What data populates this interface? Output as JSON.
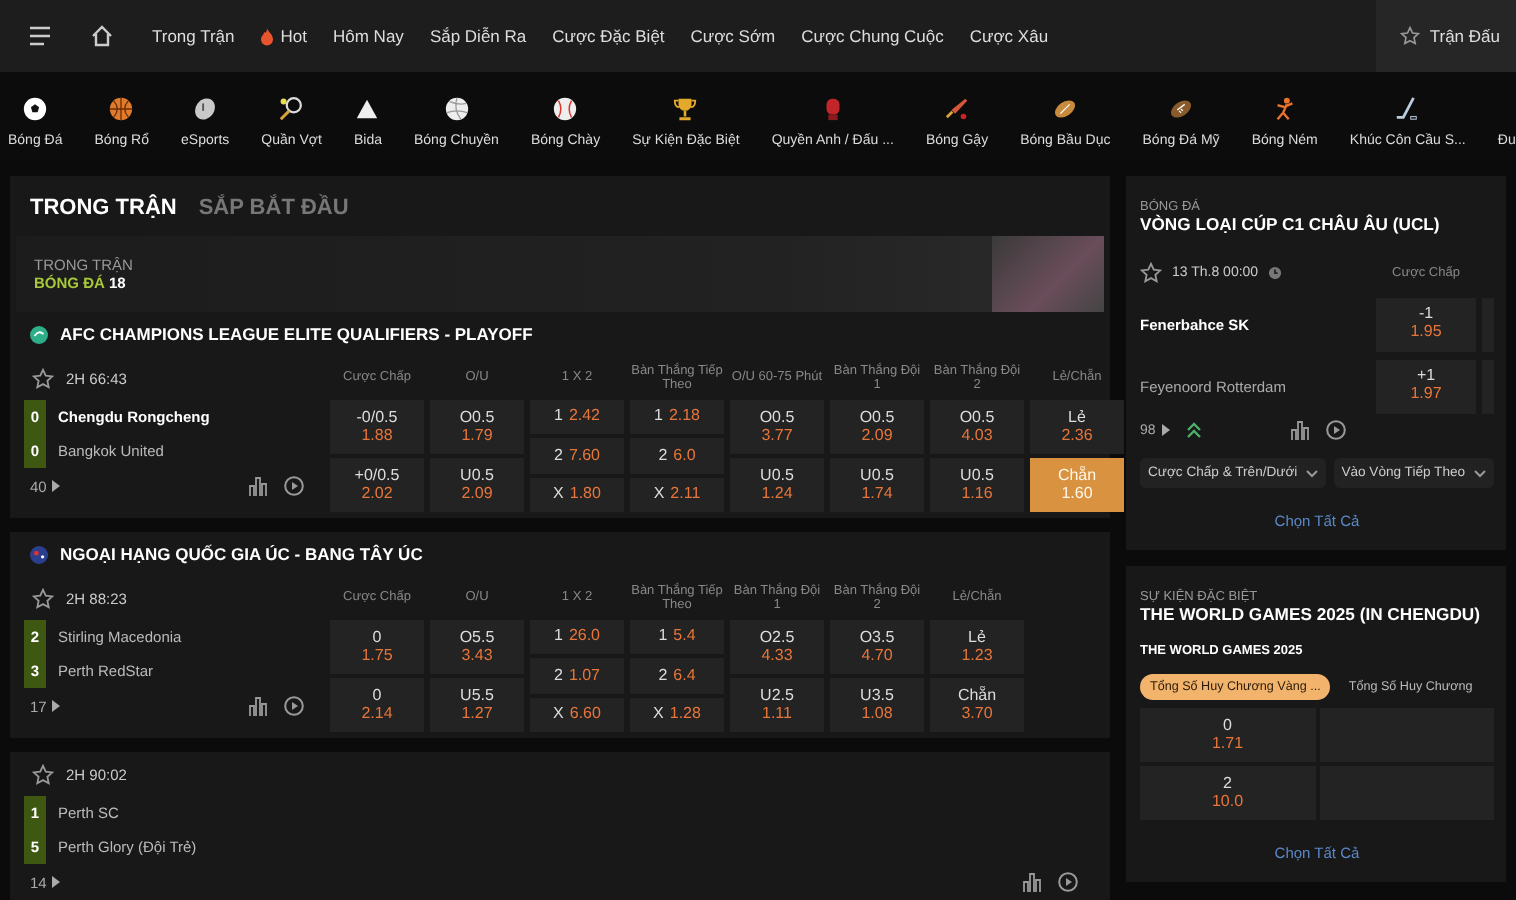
{
  "top_nav": {
    "items": [
      {
        "label": "Trong Trận"
      },
      {
        "label": "Hot"
      },
      {
        "label": "Hôm Nay"
      },
      {
        "label": "Sắp Diễn Ra"
      },
      {
        "label": "Cược Đặc Biệt"
      },
      {
        "label": "Cược Sớm"
      },
      {
        "label": "Cược Chung Cuộc"
      },
      {
        "label": "Cược Xâu"
      }
    ],
    "right_link": "Trận Đấu"
  },
  "sports": [
    {
      "label": "Bóng Đá"
    },
    {
      "label": "Bóng Rổ"
    },
    {
      "label": "eSports"
    },
    {
      "label": "Quần Vợt"
    },
    {
      "label": "Bida"
    },
    {
      "label": "Bóng Chuyền"
    },
    {
      "label": "Bóng Chày"
    },
    {
      "label": "Sự Kiện Đặc Biệt"
    },
    {
      "label": "Quyền Anh / Đấu ..."
    },
    {
      "label": "Bóng Gậy"
    },
    {
      "label": "Bóng Bầu Dục"
    },
    {
      "label": "Bóng Đá Mỹ"
    },
    {
      "label": "Bóng Ném"
    },
    {
      "label": "Khúc Côn Cầu S..."
    },
    {
      "label": "Đu"
    }
  ],
  "main": {
    "tabs": [
      {
        "label": "TRONG TRẬN",
        "selected": true
      },
      {
        "label": "SẮP BẮT ĐẦU",
        "selected": false
      }
    ],
    "banner": {
      "caption": "TRONG TRẬN",
      "sport": "BÓNG ĐÁ",
      "count": "18"
    },
    "leagues": [
      {
        "name": "AFC CHAMPIONS LEAGUE ELITE QUALIFIERS - PLAYOFF",
        "matches": [
          {
            "time": "2H 66:43",
            "more": "40",
            "teams": [
              {
                "score": "0",
                "name": "Chengdu Rongcheng",
                "bold": true
              },
              {
                "score": "0",
                "name": "Bangkok United",
                "bold": false
              }
            ],
            "columns": [
              {
                "header": "Cược Chấp",
                "kind": "pair",
                "cells": [
                  {
                    "line": "-0/0.5",
                    "odds": "1.88",
                    "selected": false
                  },
                  {
                    "line": "+0/0.5",
                    "odds": "2.02",
                    "selected": false
                  }
                ]
              },
              {
                "header": "O/U",
                "kind": "pair",
                "cells": [
                  {
                    "line": "O0.5",
                    "odds": "1.79",
                    "selected": false
                  },
                  {
                    "line": "U0.5",
                    "odds": "2.09",
                    "selected": false
                  }
                ]
              },
              {
                "header": "1 X 2",
                "kind": "triple",
                "cells": [
                  {
                    "line": "1",
                    "odds": "2.42",
                    "selected": false
                  },
                  {
                    "line": "2",
                    "odds": "7.60",
                    "selected": false
                  },
                  {
                    "line": "X",
                    "odds": "1.80",
                    "selected": false
                  }
                ]
              },
              {
                "header": "Bàn Thắng Tiếp Theo",
                "kind": "triple",
                "cells": [
                  {
                    "line": "1",
                    "odds": "2.18",
                    "selected": false
                  },
                  {
                    "line": "2",
                    "odds": "6.0",
                    "selected": false
                  },
                  {
                    "line": "X",
                    "odds": "2.11",
                    "selected": false
                  }
                ]
              },
              {
                "header": "O/U 60-75 Phút",
                "kind": "pair",
                "cells": [
                  {
                    "line": "O0.5",
                    "odds": "3.77",
                    "selected": false
                  },
                  {
                    "line": "U0.5",
                    "odds": "1.24",
                    "selected": false
                  }
                ]
              },
              {
                "header": "Bàn Thắng Đội 1",
                "kind": "pair",
                "cells": [
                  {
                    "line": "O0.5",
                    "odds": "2.09",
                    "selected": false
                  },
                  {
                    "line": "U0.5",
                    "odds": "1.74",
                    "selected": false
                  }
                ]
              },
              {
                "header": "Bàn Thắng Đội 2",
                "kind": "pair",
                "cells": [
                  {
                    "line": "O0.5",
                    "odds": "4.03",
                    "selected": false
                  },
                  {
                    "line": "U0.5",
                    "odds": "1.16",
                    "selected": false
                  }
                ]
              },
              {
                "header": "Lẻ/Chẵn",
                "kind": "pair",
                "cells": [
                  {
                    "line": "Lẻ",
                    "odds": "2.36",
                    "selected": false
                  },
                  {
                    "line": "Chẵn",
                    "odds": "1.60",
                    "selected": true
                  }
                ]
              }
            ]
          }
        ]
      },
      {
        "name": "NGOẠI HẠNG QUỐC GIA ÚC - BANG TÂY ÚC",
        "matches": [
          {
            "time": "2H 88:23",
            "more": "17",
            "teams": [
              {
                "score": "2",
                "name": "Stirling Macedonia",
                "bold": false
              },
              {
                "score": "3",
                "name": "Perth RedStar",
                "bold": false
              }
            ],
            "columns": [
              {
                "header": "Cược Chấp",
                "kind": "pair",
                "cells": [
                  {
                    "line": "0",
                    "odds": "1.75",
                    "selected": false
                  },
                  {
                    "line": "0",
                    "odds": "2.14",
                    "selected": false
                  }
                ]
              },
              {
                "header": "O/U",
                "kind": "pair",
                "cells": [
                  {
                    "line": "O5.5",
                    "odds": "3.43",
                    "selected": false
                  },
                  {
                    "line": "U5.5",
                    "odds": "1.27",
                    "selected": false
                  }
                ]
              },
              {
                "header": "1 X 2",
                "kind": "triple",
                "cells": [
                  {
                    "line": "1",
                    "odds": "26.0",
                    "selected": false
                  },
                  {
                    "line": "2",
                    "odds": "1.07",
                    "selected": false
                  },
                  {
                    "line": "X",
                    "odds": "6.60",
                    "selected": false
                  }
                ]
              },
              {
                "header": "Bàn Thắng Tiếp Theo",
                "kind": "triple",
                "cells": [
                  {
                    "line": "1",
                    "odds": "5.4",
                    "selected": false
                  },
                  {
                    "line": "2",
                    "odds": "6.4",
                    "selected": false
                  },
                  {
                    "line": "X",
                    "odds": "1.28",
                    "selected": false
                  }
                ]
              },
              {
                "header": "Bàn Thắng Đội 1",
                "kind": "pair",
                "cells": [
                  {
                    "line": "O2.5",
                    "odds": "4.33",
                    "selected": false
                  },
                  {
                    "line": "U2.5",
                    "odds": "1.11",
                    "selected": false
                  }
                ]
              },
              {
                "header": "Bàn Thắng Đội 2",
                "kind": "pair",
                "cells": [
                  {
                    "line": "O3.5",
                    "odds": "4.70",
                    "selected": false
                  },
                  {
                    "line": "U3.5",
                    "odds": "1.08",
                    "selected": false
                  }
                ]
              },
              {
                "header": "Lẻ/Chẵn",
                "kind": "pair",
                "cells": [
                  {
                    "line": "Lẻ",
                    "odds": "1.23",
                    "selected": false
                  },
                  {
                    "line": "Chẵn",
                    "odds": "3.70",
                    "selected": false
                  }
                ]
              }
            ]
          },
          {
            "time": "2H 90:02",
            "more": "14",
            "teams": [
              {
                "score": "1",
                "name": "Perth SC",
                "bold": false
              },
              {
                "score": "5",
                "name": "Perth Glory (Đội Trẻ)",
                "bold": false
              }
            ]
          }
        ]
      }
    ]
  },
  "side": {
    "cards": [
      {
        "kind": "match",
        "category": "BÓNG ĐÁ",
        "title": "VÒNG LOẠI CÚP C1 CHÂU ÂU (UCL)",
        "time": "13 Th.8 00:00",
        "column": "Cược Chấp",
        "more": "98",
        "teams": [
          {
            "name": "Fenerbahce SK",
            "bold": true
          },
          {
            "name": "Feyenoord Rotterdam",
            "bold": false
          }
        ],
        "cells": [
          {
            "line": "-1",
            "odds": "1.95",
            "selected": false
          },
          {
            "line": "+1",
            "odds": "1.97",
            "selected": false
          }
        ],
        "dropdowns": [
          "Cược Chấp & Trên/Dưới",
          "Vào Vòng Tiếp Theo"
        ],
        "select_all": "Chọn Tất Cả"
      },
      {
        "kind": "outright",
        "category": "SỰ KIỆN ĐẶC BIỆT",
        "title": "THE WORLD GAMES 2025 (IN CHENGDU)",
        "event": "THE WORLD GAMES 2025",
        "chips": [
          {
            "label": "Tổng Số Huy Chương Vàng ...",
            "selected": true
          },
          {
            "label": "Tổng Số Huy Chương",
            "selected": false
          }
        ],
        "cells": [
          {
            "line": "0",
            "odds": "1.71",
            "selected": false
          },
          {
            "line": "2",
            "odds": "10.0",
            "selected": false
          }
        ],
        "select_all": "Chọn Tất Cả"
      }
    ]
  }
}
